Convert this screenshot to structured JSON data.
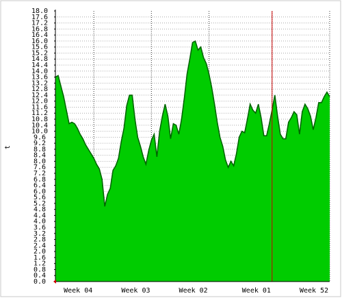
{
  "chart_data": {
    "type": "area",
    "title": "",
    "xlabel": "",
    "ylabel": "t",
    "ylim": [
      0,
      18
    ],
    "ytick_step": 0.4,
    "grid": true,
    "x_range": [
      0,
      100
    ],
    "x_ticks": [
      {
        "label": "Week 04",
        "x": 14
      },
      {
        "label": "Week 03",
        "x": 35
      },
      {
        "label": "Week 02",
        "x": 56
      },
      {
        "label": "Week 01",
        "x": 79
      },
      {
        "label": "Week 52",
        "x": 100
      }
    ],
    "marker_x": 79,
    "series": [
      {
        "x": [
          0,
          1,
          2,
          3,
          4,
          5,
          6,
          7,
          8,
          9,
          10,
          11,
          12,
          13,
          14,
          15,
          16,
          17,
          18,
          19,
          20,
          21,
          22,
          23,
          24,
          25,
          26,
          27,
          28,
          29,
          30,
          31,
          32,
          33,
          34,
          35,
          36,
          37,
          38,
          39,
          40,
          41,
          42,
          43,
          44,
          45,
          46,
          47,
          48,
          49,
          50,
          51,
          52,
          53,
          54,
          55,
          56,
          57,
          58,
          59,
          60,
          61,
          62,
          63,
          64,
          65,
          66,
          67,
          68,
          69,
          70,
          71,
          72,
          73,
          74,
          75,
          76,
          77,
          78,
          79,
          80,
          81,
          82,
          83,
          84,
          85,
          86,
          87,
          88,
          89,
          90,
          91,
          92,
          93,
          94,
          95,
          96,
          97,
          98,
          99,
          100
        ],
        "values": [
          13.6,
          13.7,
          13.0,
          12.3,
          11.4,
          10.5,
          10.6,
          10.5,
          10.2,
          9.8,
          9.5,
          9.1,
          8.8,
          8.5,
          8.2,
          7.8,
          7.5,
          6.8,
          5.0,
          5.8,
          6.2,
          7.4,
          7.7,
          8.2,
          9.3,
          10.2,
          11.7,
          12.4,
          12.4,
          10.8,
          9.6,
          9.0,
          8.3,
          7.8,
          8.7,
          9.4,
          9.8,
          8.3,
          10.0,
          11.0,
          11.8,
          11.0,
          9.5,
          10.5,
          10.4,
          9.8,
          10.8,
          12.2,
          13.8,
          14.8,
          15.9,
          16.0,
          15.4,
          15.6,
          14.9,
          14.5,
          13.8,
          12.9,
          11.8,
          10.6,
          9.6,
          9.0,
          8.1,
          7.6,
          8.0,
          7.7,
          8.5,
          9.6,
          10.0,
          9.9,
          10.8,
          11.8,
          11.4,
          11.2,
          11.8,
          10.9,
          9.7,
          9.7,
          10.5,
          11.4,
          12.4,
          11.0,
          9.8,
          9.5,
          9.5,
          10.6,
          10.9,
          11.3,
          11.1,
          9.8,
          11.3,
          11.8,
          11.5,
          11.0,
          10.1,
          10.9,
          11.9,
          11.9,
          12.3,
          12.6,
          12.3
        ]
      }
    ],
    "colors": {
      "fill": "#00cc00",
      "edge": "#006600",
      "grid": "#aaaaaa",
      "vgrid": "#333333",
      "marker": "#cc0000",
      "axis": "#000000"
    }
  }
}
